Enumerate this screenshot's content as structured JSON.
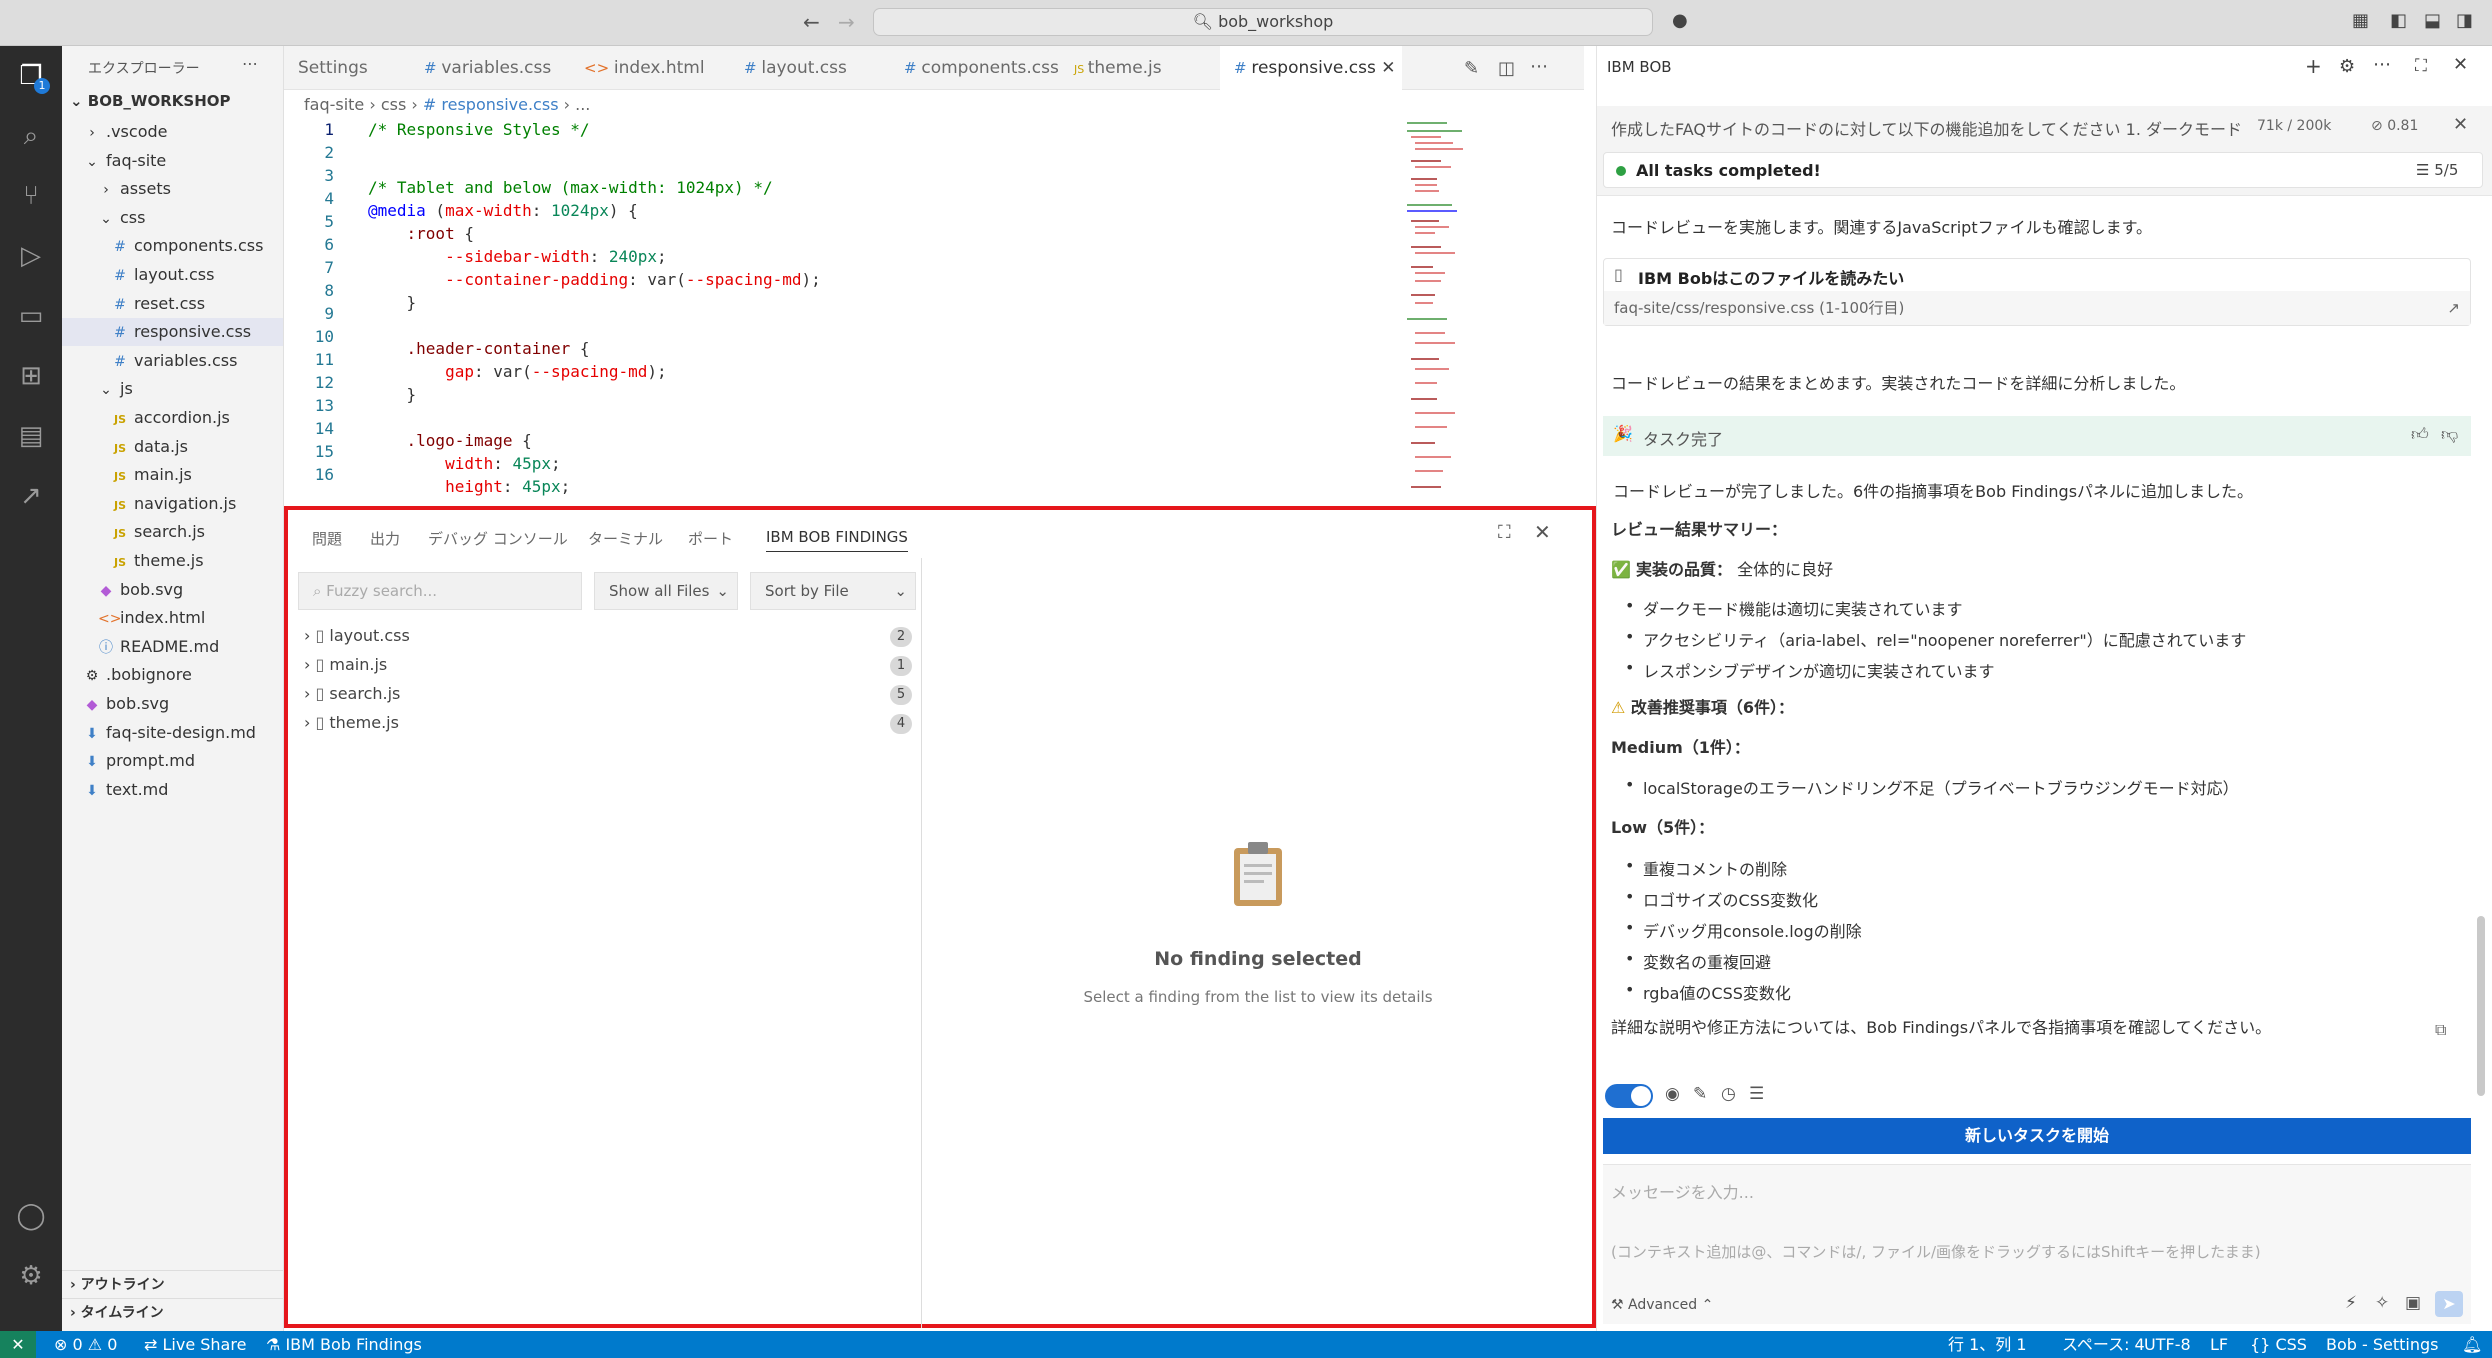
{
  "window": {
    "title": "bob_workshop"
  },
  "explorer": {
    "title": "エクスプローラー",
    "root": "BOB_WORKSHOP",
    "items": [
      {
        "label": ".vscode",
        "type": "folder",
        "depth": 1
      },
      {
        "label": "faq-site",
        "type": "folder",
        "depth": 1
      },
      {
        "label": "assets",
        "type": "folder",
        "depth": 2
      },
      {
        "label": "css",
        "type": "folder",
        "depth": 2
      },
      {
        "label": "components.css",
        "type": "css",
        "depth": 3
      },
      {
        "label": "layout.css",
        "type": "css",
        "depth": 3
      },
      {
        "label": "reset.css",
        "type": "css",
        "depth": 3
      },
      {
        "label": "responsive.css",
        "type": "css",
        "depth": 3
      },
      {
        "label": "variables.css",
        "type": "css",
        "depth": 3
      },
      {
        "label": "js",
        "type": "folder",
        "depth": 2
      },
      {
        "label": "accordion.js",
        "type": "js",
        "depth": 3
      },
      {
        "label": "data.js",
        "type": "js",
        "depth": 3
      },
      {
        "label": "main.js",
        "type": "js",
        "depth": 3
      },
      {
        "label": "navigation.js",
        "type": "js",
        "depth": 3
      },
      {
        "label": "search.js",
        "type": "js",
        "depth": 3
      },
      {
        "label": "theme.js",
        "type": "js",
        "depth": 3
      },
      {
        "label": "bob.svg",
        "type": "svg",
        "depth": 2
      },
      {
        "label": "index.html",
        "type": "html",
        "depth": 2
      },
      {
        "label": "README.md",
        "type": "info",
        "depth": 2
      },
      {
        "label": ".bobignore",
        "type": "gear",
        "depth": 1
      },
      {
        "label": "bob.svg",
        "type": "svg",
        "depth": 1
      },
      {
        "label": "faq-site-design.md",
        "type": "md",
        "depth": 1
      },
      {
        "label": "prompt.md",
        "type": "md",
        "depth": 1
      },
      {
        "label": "text.md",
        "type": "md",
        "depth": 1
      }
    ],
    "outline": "アウトライン",
    "timeline": "タイムライン"
  },
  "tabs": [
    {
      "label": "Settings",
      "icon": ""
    },
    {
      "label": "variables.css",
      "icon": "#"
    },
    {
      "label": "index.html",
      "icon": "<>"
    },
    {
      "label": "layout.css",
      "icon": "#"
    },
    {
      "label": "components.css",
      "icon": "#"
    },
    {
      "label": "theme.js",
      "icon": "JS"
    },
    {
      "label": "responsive.css",
      "icon": "#"
    }
  ],
  "breadcrumb": {
    "a": "faq-site",
    "b": "css",
    "c": "# responsive.css",
    "d": "..."
  },
  "editor": {
    "lines": [
      "1",
      "2",
      "3",
      "4",
      "5",
      "6",
      "7",
      "8",
      "9",
      "10",
      "11",
      "12",
      "13",
      "14",
      "15",
      "16"
    ]
  },
  "panel": {
    "tabs": [
      "問題",
      "出力",
      "デバッグ コンソール",
      "ターミナル",
      "ポート",
      "IBM BOB FINDINGS"
    ],
    "search_placeholder": "Fuzzy search...",
    "filter": "Show all Files",
    "sort": "Sort by File",
    "files": [
      {
        "name": "layout.css",
        "count": "2"
      },
      {
        "name": "main.js",
        "count": "1"
      },
      {
        "name": "search.js",
        "count": "5"
      },
      {
        "name": "theme.js",
        "count": "4"
      }
    ],
    "empty_title": "No finding selected",
    "empty_sub": "Select a finding from the list to view its details"
  },
  "chat": {
    "title": "IBM BOB",
    "task_title": "作成したFAQサイトのコードのに対して以下の機能追加をしてください 1. ダークモードへ...",
    "tokens": "71k / 200k",
    "cost": "0.81",
    "tasks_done": "All tasks completed!",
    "tasks_count": "5/5",
    "msg1": "コードレビューを実施します。関連するJavaScriptファイルも確認します。",
    "file_card_title": "IBM Bobはこのファイルを読みたい",
    "file_card_path": "faq-site/css/responsive.css",
    "file_card_range": "(1-100行目)",
    "msg2": "コードレビューの結果をまとめます。実装されたコードを詳細に分析しました。",
    "done_label": "タスク完了",
    "done_intro": "コードレビューが完了しました。6件の指摘事項をBob Findingsパネルに追加しました。",
    "summary_heading": "レビュー結果サマリー：",
    "quality_label": "実装の品質：",
    "quality_value": "全体的に良好",
    "quality_items": [
      "ダークモード機能は適切に実装されています",
      "アクセシビリティ（aria-label、rel=\"noopener noreferrer\"）に配慮されています",
      "レスポンシブデザインが適切に実装されています"
    ],
    "improve_heading": "改善推奨事項（6件）：",
    "medium_heading": "Medium（1件）：",
    "medium_items": [
      "localStorageのエラーハンドリング不足（プライベートブラウジングモード対応）"
    ],
    "low_heading": "Low（5件）：",
    "low_items": [
      "重複コメントの削除",
      "ロゴサイズのCSS変数化",
      "デバッグ用console.logの削除",
      "変数名の重複回避",
      "rgba値のCSS変数化"
    ],
    "closing": "詳細な説明や修正方法については、Bob Findingsパネルで各指摘事項を確認してください。",
    "new_task_button": "新しいタスクを開始",
    "input_placeholder": "メッセージを入力...",
    "input_hint": "(コンテキスト追加は@、コマンドは/, ファイル/画像をドラッグするにはShiftキーを押したまま)",
    "advanced": "Advanced"
  },
  "statusbar": {
    "problems": "⊗ 0 ⚠ 0",
    "liveshare": "Live Share",
    "findings": "IBM Bob Findings",
    "position": "行 1、列 1",
    "spaces": "スペース: 4",
    "encoding": "UTF-8",
    "eol": "LF",
    "language": "CSS",
    "settings": "Bob - Settings"
  },
  "colors": {
    "accent": "#007acc",
    "highlight_border": "#e5161b",
    "success": "#2ea043"
  }
}
